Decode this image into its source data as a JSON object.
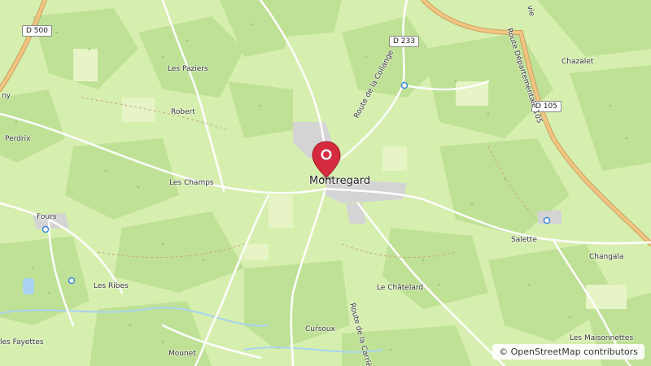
{
  "map": {
    "center_place": "Montregard",
    "marker_icon": "location-pin-icon",
    "marker_color": "#d52b3f",
    "water_color": "#a9d3f0",
    "road_color": "#ffffff",
    "main_road_color": "#f2c582"
  },
  "places": {
    "montregard": "Montregard",
    "les_paziers": "Les Paziers",
    "robert": "Robert",
    "perdrix": "Perdrix",
    "les_champs": "Les Champs",
    "fours": "Fours",
    "les_ribes": "Les Ribes",
    "les_fayettes": "les Fayettes",
    "mounet": "Mounet",
    "cursoux": "Cursoux",
    "le_chatelard": "Le Châtelard",
    "salette": "Salette",
    "changala": "Changala",
    "chazalet": "Chazalet",
    "les_maisonnettes": "Les Maisonnettes",
    "ny": "ny"
  },
  "roads": {
    "d500": "D 500",
    "d233": "D 233",
    "d105": "D 105",
    "route_collange": "Route de la Collange",
    "route_carriere": "Route de la Carrière",
    "route_departementale": "Route Départementale 105",
    "vie": "vie"
  },
  "attribution": {
    "symbol": "©",
    "text": "OpenStreetMap contributors"
  }
}
